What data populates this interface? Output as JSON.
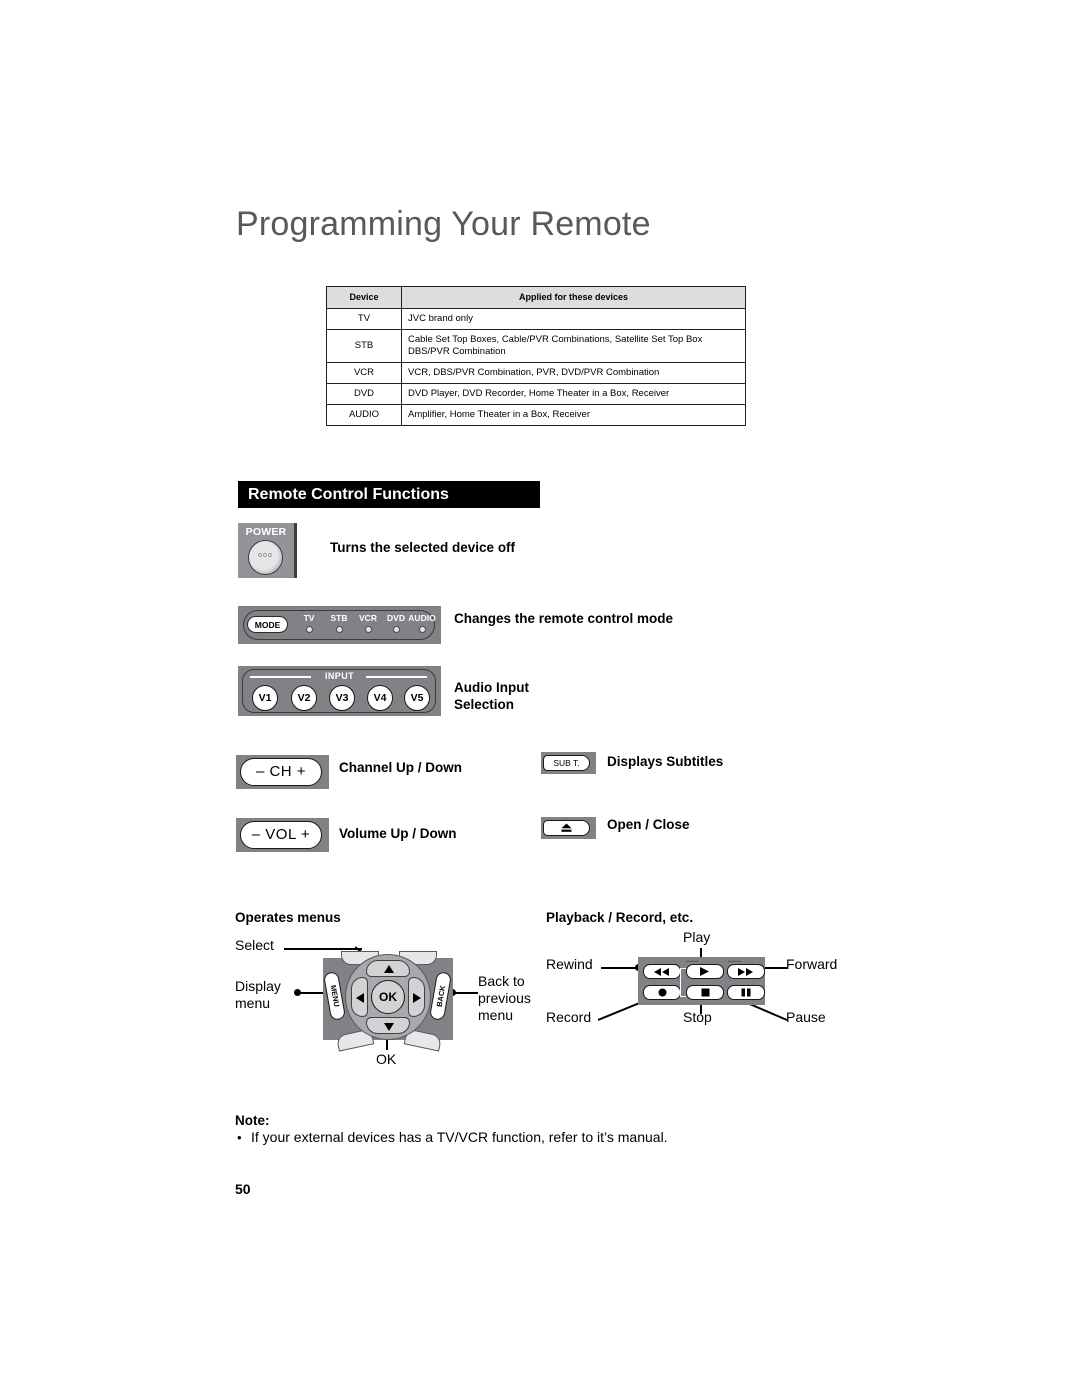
{
  "page": {
    "title": "Programming Your Remote",
    "number": "50"
  },
  "device_table": {
    "headers": [
      "Device",
      "Applied for these devices"
    ],
    "rows": [
      {
        "device": "TV",
        "applied": "JVC brand only"
      },
      {
        "device": "STB",
        "applied": "Cable Set Top Boxes, Cable/PVR Combinations, Satellite Set Top Box DBS/PVR Combination"
      },
      {
        "device": "VCR",
        "applied": "VCR, DBS/PVR Combination, PVR, DVD/PVR Combination"
      },
      {
        "device": "DVD",
        "applied": "DVD Player, DVD Recorder, Home Theater in a Box, Receiver"
      },
      {
        "device": "AUDIO",
        "applied": "Amplifier, Home Theater in a Box, Receiver"
      }
    ]
  },
  "section": {
    "heading": "Remote Control Functions"
  },
  "functions": {
    "power": {
      "button_label": "POWER",
      "dots": "ooo",
      "description": "Turns the selected device off"
    },
    "mode": {
      "button_label": "MODE",
      "indicators": [
        "TV",
        "STB",
        "VCR",
        "DVD",
        "AUDIO"
      ],
      "description": "Changes the remote control mode"
    },
    "input": {
      "group_label": "INPUT",
      "buttons": [
        "V1",
        "V2",
        "V3",
        "V4",
        "V5"
      ],
      "description_line1": "Audio Input",
      "description_line2": "Selection"
    },
    "channel": {
      "button_label": "– CH +",
      "description": "Channel Up / Down"
    },
    "volume": {
      "button_label": "– VOL +",
      "description": "Volume Up / Down"
    },
    "subtitle": {
      "button_label": "SUB T.",
      "description": "Displays Subtitles"
    },
    "eject": {
      "button_label": "eject-icon",
      "description": "Open / Close"
    }
  },
  "navigation": {
    "heading": "Operates menus",
    "ok_label": "OK",
    "menu_key_label": "MENU",
    "back_key_label": "BACK",
    "callouts": {
      "select": "Select",
      "display_menu_line1": "Display",
      "display_menu_line2": "menu",
      "back_line1": "Back to",
      "back_line2": "previous",
      "back_line3": "menu",
      "ok": "OK"
    }
  },
  "playback": {
    "heading": "Playback / Record, etc.",
    "callouts": {
      "play": "Play",
      "rewind": "Rewind",
      "forward": "Forward",
      "record": "Record",
      "stop": "Stop",
      "pause": "Pause"
    },
    "buttons": [
      {
        "name": "rewind",
        "glyph": "◀◀"
      },
      {
        "name": "play",
        "glyph": "▶"
      },
      {
        "name": "forward",
        "glyph": "▶▶"
      },
      {
        "name": "record",
        "glyph": "●"
      },
      {
        "name": "stop",
        "glyph": "■"
      },
      {
        "name": "pause",
        "glyph": "❚❚"
      }
    ]
  },
  "note": {
    "title": "Note:",
    "bullet": "•",
    "text": "If your external devices has a TV/VCR function, refer to it’s manual."
  },
  "colors": {
    "title_gray": "#58595b",
    "table_header_bg": "#dcdddf",
    "section_bar_bg": "#000000",
    "remote_body_gray": "#808285",
    "button_face": "#ffffff"
  }
}
